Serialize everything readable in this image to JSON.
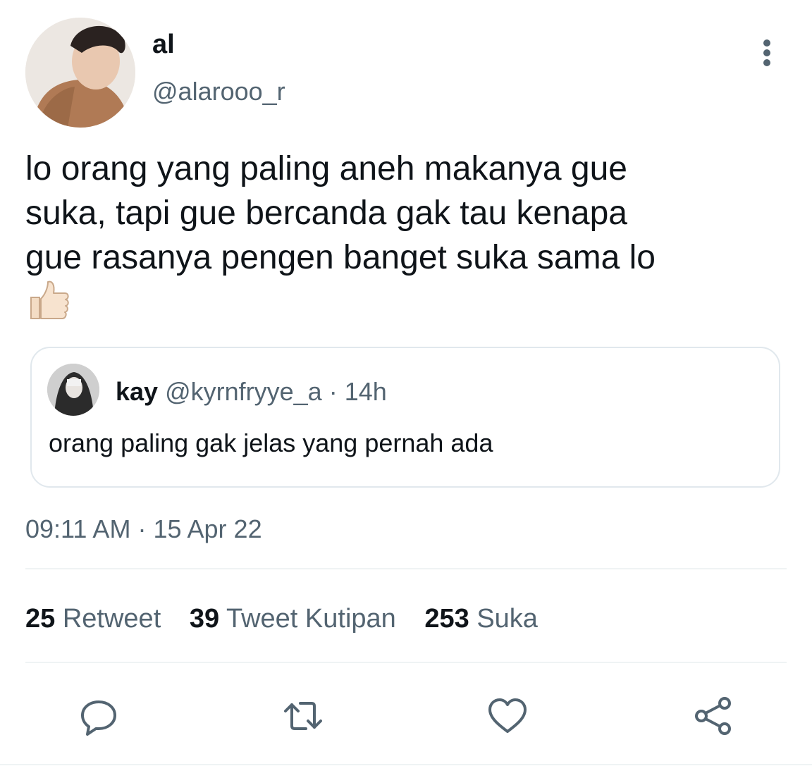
{
  "tweet": {
    "author": {
      "name": "al",
      "handle": "@alarooo_r"
    },
    "text_lines": [
      "lo orang yang paling aneh makanya gue",
      "suka, tapi gue bercanda gak tau kenapa",
      "gue rasanya pengen banget suka sama lo"
    ],
    "emoji": "👍🏻",
    "time": "09:11 AM",
    "separator": "·",
    "date": "15 Apr 22"
  },
  "quote": {
    "name": "kay",
    "handle": "@kyrnfryye_a",
    "separator": "·",
    "age": "14h",
    "text": "orang paling gak jelas yang pernah ada"
  },
  "stats": [
    {
      "count": "25",
      "label": "Retweet"
    },
    {
      "count": "39",
      "label": "Tweet Kutipan"
    },
    {
      "count": "253",
      "label": "Suka"
    }
  ],
  "actions": [
    "reply-icon",
    "retweet-icon",
    "like-icon",
    "share-icon"
  ],
  "colors": {
    "secondary_text": "#536471",
    "divider": "#eff3f4",
    "primary_text": "#0f1419"
  }
}
